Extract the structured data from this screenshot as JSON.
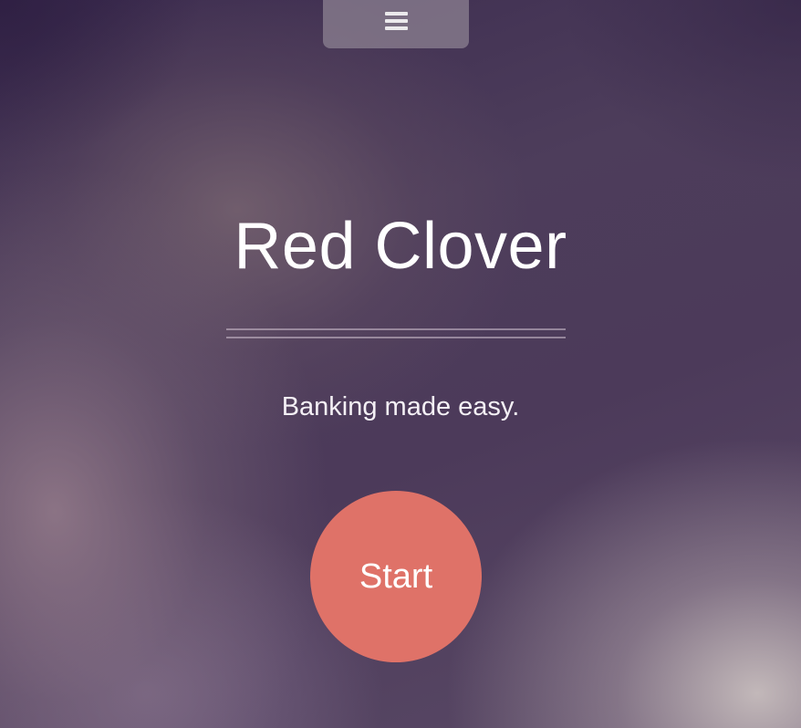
{
  "nav": {
    "menu_icon": "hamburger-menu-icon"
  },
  "hero": {
    "title": "Red Clover",
    "tagline": "Banking made easy.",
    "start_label": "Start"
  },
  "colors": {
    "accent": "#df7268",
    "background": "#4a3a5a",
    "text": "#ffffff"
  }
}
